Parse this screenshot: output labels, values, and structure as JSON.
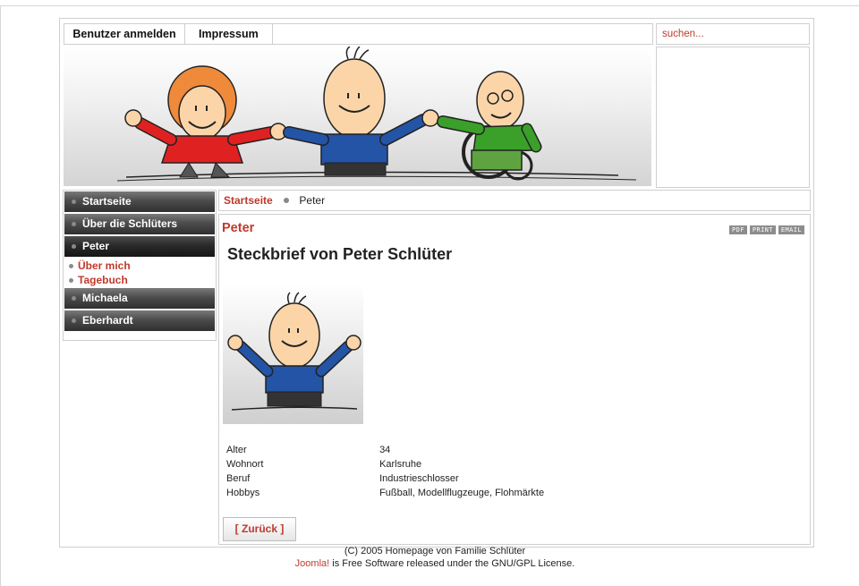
{
  "topnav": {
    "login": "Benutzer anmelden",
    "impressum": "Impressum"
  },
  "search": {
    "placeholder": "suchen..."
  },
  "menu": {
    "items": [
      {
        "label": "Startseite"
      },
      {
        "label": "Über die Schlüters"
      },
      {
        "label": "Peter"
      },
      {
        "label": "Michaela"
      },
      {
        "label": "Eberhardt"
      }
    ],
    "subitems": [
      {
        "label": "Über mich"
      },
      {
        "label": "Tagebuch"
      }
    ]
  },
  "breadcrumb": {
    "home": "Startseite",
    "current": "Peter"
  },
  "content": {
    "title": "Peter",
    "heading": "Steckbrief von Peter Schlüter",
    "icons": {
      "pdf": "PDF",
      "print": "PRINT",
      "email": "EMAIL"
    },
    "profile": [
      {
        "label": "Alter",
        "value": "34"
      },
      {
        "label": "Wohnort",
        "value": "Karlsruhe"
      },
      {
        "label": "Beruf",
        "value": "Industrieschlosser"
      },
      {
        "label": "Hobbys",
        "value": "Fußball, Modellflugzeuge, Flohmärkte"
      }
    ],
    "back": "[ Zurück ]"
  },
  "footer": {
    "line1": "(C) 2005 Homepage von Familie Schlüter",
    "joomla": "Joomla!",
    "line2": " is Free Software released under the GNU/GPL License."
  },
  "colors": {
    "accent": "#c0392b",
    "menu_bg": "#3a3a3a",
    "border": "#cfcfcf"
  }
}
